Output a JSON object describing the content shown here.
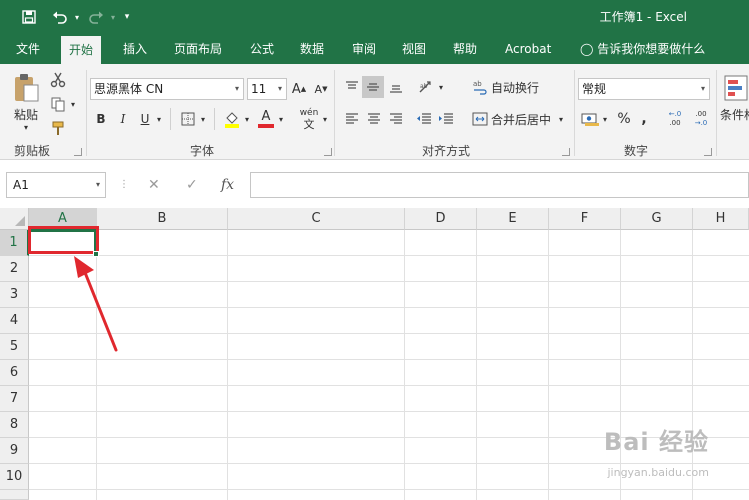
{
  "titlebar": {
    "title": "工作簿1  -  Excel",
    "save_icon": "save-icon",
    "undo_icon": "undo-icon",
    "redo_icon": "redo-icon",
    "customize_icon": "customize-quick-access-icon"
  },
  "tabs": [
    "文件",
    "开始",
    "插入",
    "页面布局",
    "公式",
    "数据",
    "审阅",
    "视图",
    "帮助",
    "Acrobat",
    "告诉我你想要做什么"
  ],
  "active_tab": "开始",
  "clipboard": {
    "paste_label": "粘贴",
    "group_label": "剪贴板"
  },
  "font": {
    "font_name": "思源黑体 CN",
    "font_size": "11",
    "bold": "B",
    "italic": "I",
    "underline": "U",
    "grow": "A",
    "shrink": "A",
    "font_color_letter": "A",
    "phonetic": "wén",
    "phonetic_char": "文",
    "group_label": "字体"
  },
  "alignment": {
    "wrap_text": "自动换行",
    "merge_center": "合并后居中",
    "group_label": "对齐方式"
  },
  "number": {
    "format": "常规",
    "percent": "%",
    "comma": ",",
    "group_label": "数字",
    "increase_decimal": ".0 .00",
    "decrease_decimal": ".00 .0"
  },
  "styles": {
    "conditional_label": "条件格"
  },
  "formula_bar": {
    "name_box": "A1",
    "fx": "fx",
    "cancel": "✕",
    "enter": "✓",
    "value": ""
  },
  "grid": {
    "columns": [
      "A",
      "B",
      "C",
      "D",
      "E",
      "F",
      "G",
      "H"
    ],
    "rows": [
      "1",
      "2",
      "3",
      "4",
      "5",
      "6",
      "7",
      "8",
      "9",
      "10"
    ],
    "selected_cell": "A1"
  },
  "colors": {
    "brand": "#217346",
    "highlight_box": "#e0282e",
    "arrow": "#e0282e",
    "fill_yellow": "#ffff00",
    "font_red": "#e0282e"
  },
  "watermark": {
    "brand": "Bai 经验",
    "url": "jingyan.baidu.com"
  }
}
